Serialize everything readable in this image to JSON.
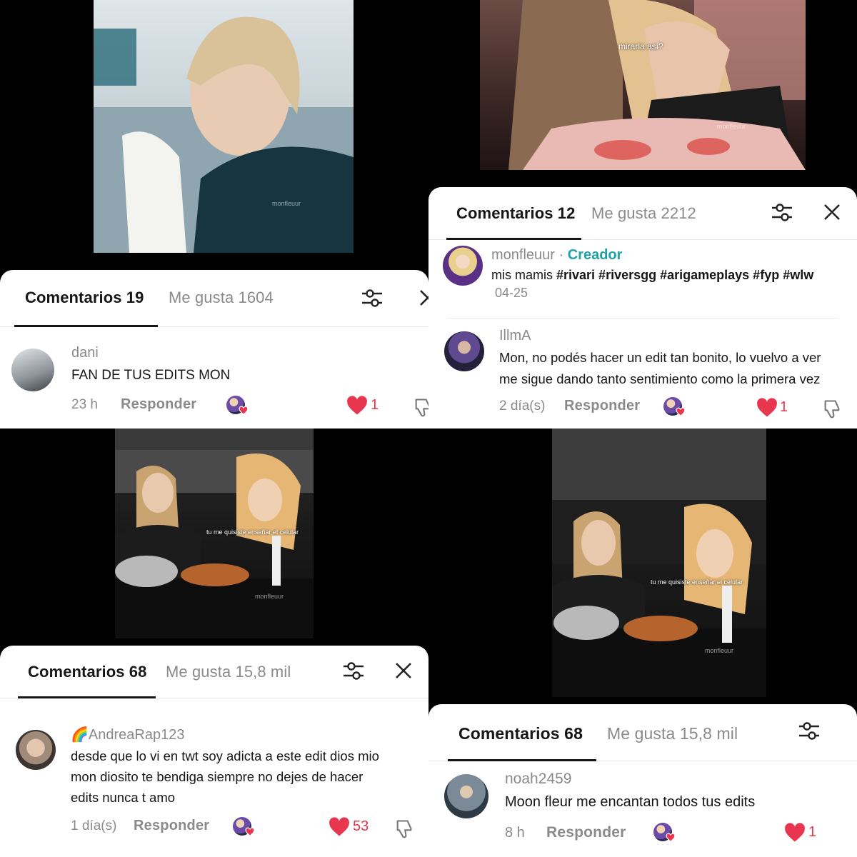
{
  "panels": [
    {
      "comments_label": "Comentarios 19",
      "likes_label": "Me gusta 1604",
      "comments": [
        {
          "user": "dani",
          "text": "FAN DE TUS EDITS MON",
          "time": "23 h",
          "reply": "Responder",
          "likes": "1"
        }
      ]
    },
    {
      "video_overlay": "mirarla así?",
      "watermark": "monfleuur",
      "comments_label": "Comentarios 12",
      "likes_label": "Me gusta 2212",
      "creator_post": {
        "user": "monfleuur",
        "separator": "·",
        "badge": "Creador",
        "caption_plain": "mis mamis",
        "caption_tags": "#rivari #riversgg #arigameplays #fyp #wlw",
        "date": "04-25"
      },
      "comments": [
        {
          "user": "IllmA",
          "text_line1": "Mon, no podés hacer un edit tan bonito, lo vuelvo a ver",
          "text_line2": "me sigue dando tanto sentimiento como la primera vez",
          "time": "2 día(s)",
          "reply": "Responder",
          "likes": "1"
        }
      ]
    },
    {
      "video_overlay": "tu me quisiste enseñar el celular",
      "watermark": "monfleuur",
      "comments_label": "Comentarios 68",
      "likes_label": "Me gusta 15,8 mil",
      "comments": [
        {
          "user": "🌈AndreaRap123",
          "text_line1": "desde que lo vi en twt soy adicta a este edit dios mio",
          "text_line2": "mon diosito te bendiga siempre no dejes de hacer",
          "text_line3": "edits nunca t amo",
          "time": "1 día(s)",
          "reply": "Responder",
          "likes": "53"
        }
      ]
    },
    {
      "video_overlay": "tu me quisiste enseñar el celular",
      "watermark": "monfleuur",
      "comments_label": "Comentarios 68",
      "likes_label": "Me gusta 15,8 mil",
      "comments": [
        {
          "user": "noah2459",
          "text": "Moon fleur me encantan todos tus edits",
          "time": "8 h",
          "reply": "Responder",
          "likes": "1"
        }
      ]
    }
  ],
  "colors": {
    "accent_like": "#e8364f",
    "creator": "#1ea4a8",
    "text": "#161616",
    "muted": "#8a8a8a"
  }
}
